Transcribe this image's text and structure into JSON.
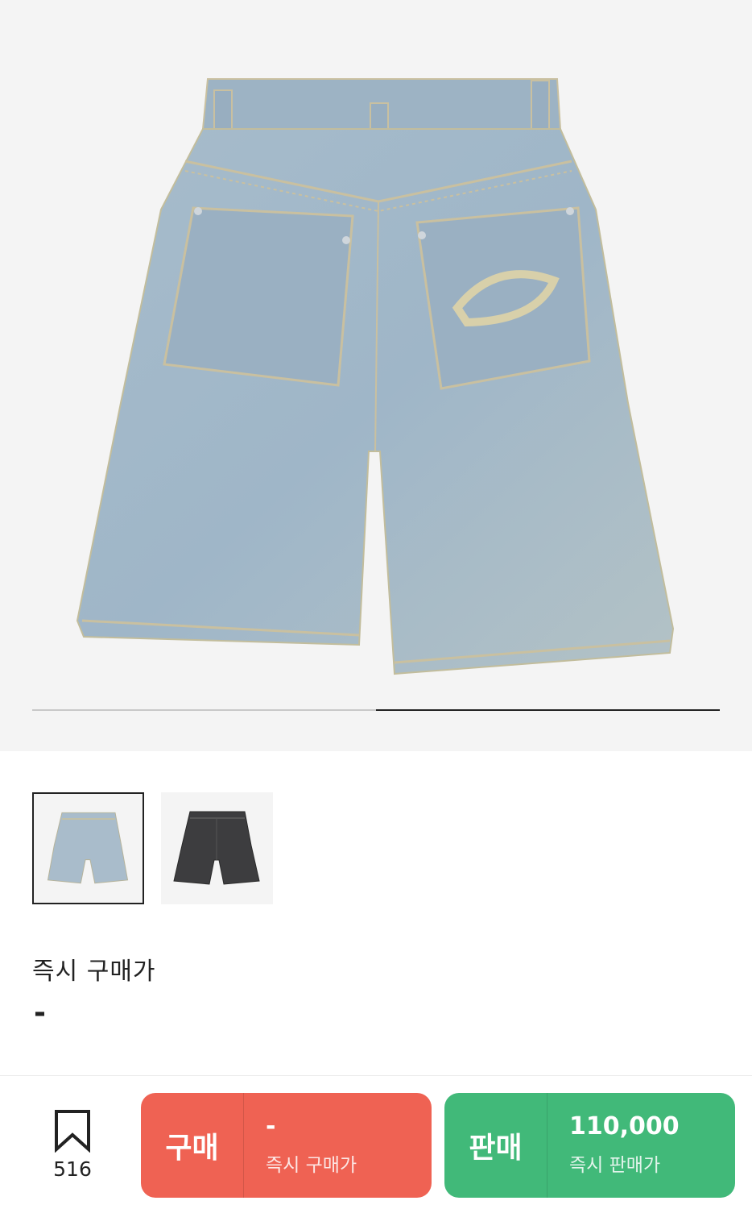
{
  "colors": {
    "buy": "#ef6253",
    "sell": "#41b979",
    "text": "#222222",
    "hero_bg": "#f4f4f4"
  },
  "gallery": {
    "progress": 0.5,
    "thumbnails": [
      {
        "name": "light-wash-shorts",
        "selected": true
      },
      {
        "name": "black-wash-shorts",
        "selected": false
      }
    ]
  },
  "price": {
    "label": "즉시 구매가",
    "value": "-"
  },
  "wish": {
    "icon": "bookmark-icon",
    "count": "516"
  },
  "buy_button": {
    "label": "구매",
    "amount": "-",
    "sub": "즉시 구매가"
  },
  "sell_button": {
    "label": "판매",
    "amount": "110,000",
    "sub": "즉시 판매가"
  }
}
